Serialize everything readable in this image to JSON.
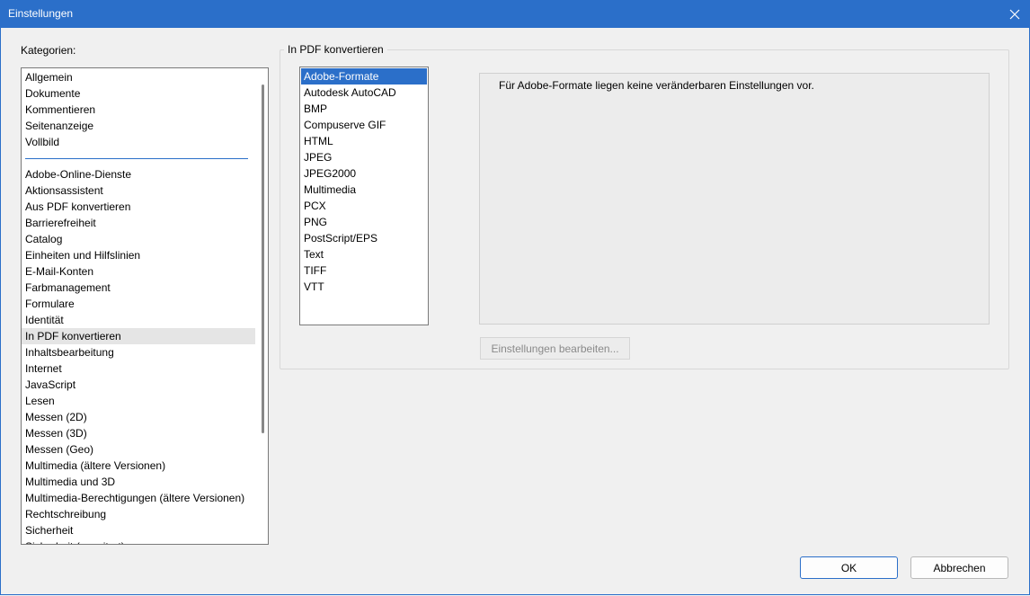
{
  "window": {
    "title": "Einstellungen"
  },
  "categories": {
    "label": "Kategorien:",
    "top_items": [
      "Allgemein",
      "Dokumente",
      "Kommentieren",
      "Seitenanzeige",
      "Vollbild"
    ],
    "items": [
      "Adobe-Online-Dienste",
      "Aktionsassistent",
      "Aus PDF konvertieren",
      "Barrierefreiheit",
      "Catalog",
      "Einheiten und Hilfslinien",
      "E-Mail-Konten",
      "Farbmanagement",
      "Formulare",
      "Identität",
      "In PDF konvertieren",
      "Inhaltsbearbeitung",
      "Internet",
      "JavaScript",
      "Lesen",
      "Messen (2D)",
      "Messen (3D)",
      "Messen (Geo)",
      "Multimedia (ältere Versionen)",
      "Multimedia und 3D",
      "Multimedia-Berechtigungen (ältere Versionen)",
      "Rechtschreibung",
      "Sicherheit",
      "Sicherheit (erweitert)"
    ],
    "selected": "In PDF konvertieren"
  },
  "panel": {
    "group_label": "In PDF konvertieren",
    "formats": [
      "Adobe-Formate",
      "Autodesk AutoCAD",
      "BMP",
      "Compuserve GIF",
      "HTML",
      "JPEG",
      "JPEG2000",
      "Multimedia",
      "PCX",
      "PNG",
      "PostScript/EPS",
      "Text",
      "TIFF",
      "VTT"
    ],
    "selected_format": "Adobe-Formate",
    "info_text": "Für Adobe-Formate liegen keine veränderbaren Einstellungen vor.",
    "edit_button": "Einstellungen bearbeiten..."
  },
  "buttons": {
    "ok": "OK",
    "cancel": "Abbrechen"
  },
  "colors": {
    "accent": "#2b6fc9",
    "selection_gray": "#e5e5e5"
  }
}
